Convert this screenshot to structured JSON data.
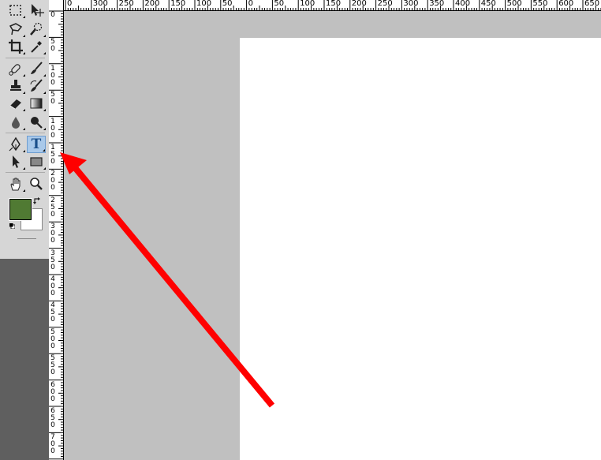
{
  "app": "Photoshop",
  "toolbar": {
    "tools": [
      {
        "id": "marquee",
        "icon": "rectangular-marquee-icon"
      },
      {
        "id": "move",
        "icon": "move-icon"
      },
      {
        "id": "lasso",
        "icon": "polygonal-lasso-icon"
      },
      {
        "id": "quick-select",
        "icon": "quick-selection-icon"
      },
      {
        "id": "crop",
        "icon": "crop-icon"
      },
      {
        "id": "eyedropper",
        "icon": "eyedropper-icon"
      },
      {
        "id": "healing",
        "icon": "spot-healing-brush-icon"
      },
      {
        "id": "brush",
        "icon": "brush-icon"
      },
      {
        "id": "clone",
        "icon": "clone-stamp-icon"
      },
      {
        "id": "history-brush",
        "icon": "history-brush-icon"
      },
      {
        "id": "eraser",
        "icon": "eraser-icon"
      },
      {
        "id": "gradient",
        "icon": "gradient-icon"
      },
      {
        "id": "blur",
        "icon": "blur-icon"
      },
      {
        "id": "dodge",
        "icon": "dodge-icon"
      },
      {
        "id": "pen",
        "icon": "pen-icon"
      },
      {
        "id": "type",
        "icon": "horizontal-type-icon",
        "active": true
      },
      {
        "id": "path-select",
        "icon": "path-selection-icon"
      },
      {
        "id": "shape",
        "icon": "rectangle-shape-icon"
      },
      {
        "id": "hand",
        "icon": "hand-icon"
      },
      {
        "id": "zoom",
        "icon": "zoom-icon"
      }
    ],
    "type_tool_glyph": "T",
    "foreground_color": "#507a33",
    "background_color": "#ffffff"
  },
  "rulers": {
    "horizontal_labels": [
      "0",
      "300",
      "250",
      "200",
      "150",
      "100",
      "50",
      "0",
      "50",
      "100",
      "150",
      "200",
      "250",
      "300",
      "350",
      "400",
      "450",
      "500",
      "550",
      "600",
      "650"
    ],
    "vertical_labels": [
      "0",
      "5\n0",
      "1\n0\n0",
      "5\n0",
      "1\n0\n0",
      "1\n5\n0",
      "2\n0\n0",
      "2\n5\n0",
      "3\n0\n0",
      "3\n5\n0",
      "4\n0\n0",
      "4\n5\n0",
      "5\n0\n0",
      "5\n5\n0",
      "6\n0\n0",
      "6\n5\n0",
      "7\n0\n0",
      "7\n5\n0"
    ]
  },
  "colors": {
    "workspace": "#c0c0c0",
    "canvas": "#ffffff",
    "annotation_arrow": "#ff0000",
    "active_tool_highlight": "#a9c9ea"
  }
}
